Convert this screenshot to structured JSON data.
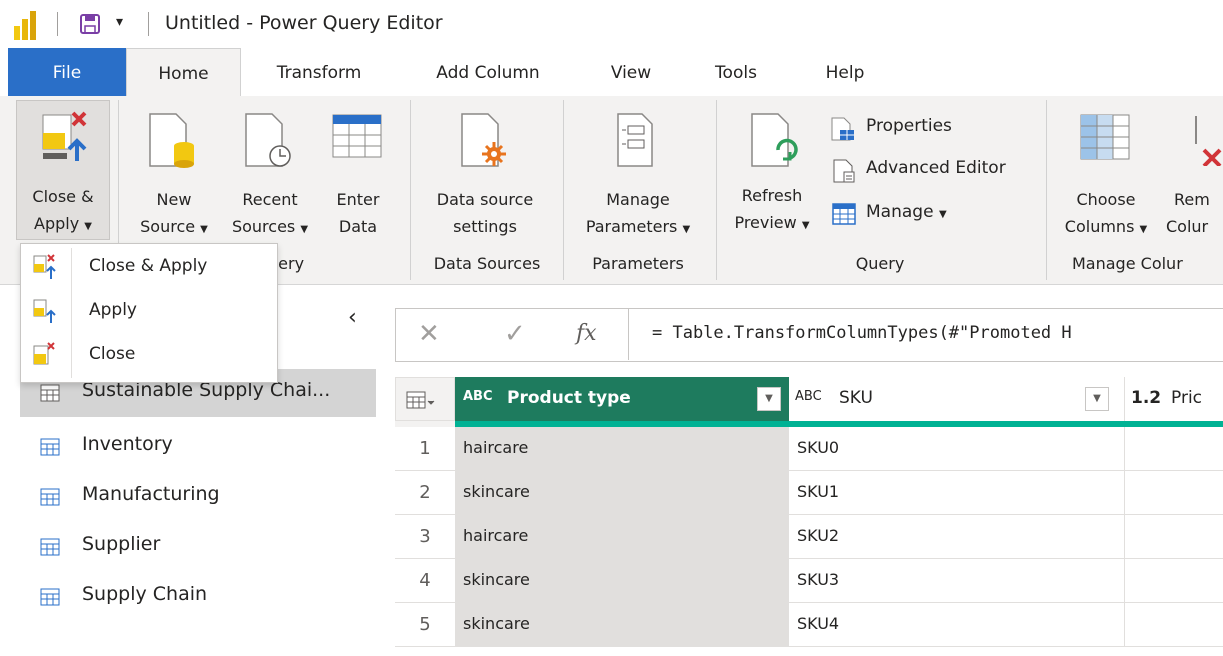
{
  "titlebar": {
    "title": "Untitled - Power Query Editor",
    "qat_dropdown": "▾"
  },
  "tabs": [
    "File",
    "Home",
    "Transform",
    "Add Column",
    "View",
    "Tools",
    "Help"
  ],
  "ribbon": {
    "close_apply": {
      "line1": "Close &",
      "line2": "Apply"
    },
    "new_source": {
      "line1": "New",
      "line2": "Source"
    },
    "recent_sources": {
      "line1": "Recent",
      "line2": "Sources"
    },
    "enter_data": {
      "line1": "Enter",
      "line2": "Data"
    },
    "data_source_settings": {
      "line1": "Data source",
      "line2": "settings"
    },
    "manage_parameters": {
      "line1": "Manage",
      "line2": "Parameters"
    },
    "refresh_preview": {
      "line1": "Refresh",
      "line2": "Preview"
    },
    "properties": "Properties",
    "advanced_editor": "Advanced Editor",
    "manage": "Manage",
    "choose_columns": {
      "line1": "Choose",
      "line2": "Columns"
    },
    "remove_columns": {
      "line1": "Rem",
      "line2": "Colur"
    },
    "groups": {
      "new_query": "uery",
      "data_sources": "Data Sources",
      "parameters": "Parameters",
      "query": "Query",
      "manage_columns": "Manage Colur"
    }
  },
  "dropdown": {
    "items": [
      "Close & Apply",
      "Apply",
      "Close"
    ]
  },
  "queries": [
    "Sustainable Supply Chai...",
    "Inventory",
    "Manufacturing",
    "Supplier",
    "Supply Chain"
  ],
  "formula": {
    "cancel": "✕",
    "confirm": "✓",
    "fx": "fx",
    "text": "= Table.TransformColumnTypes(#\"Promoted H"
  },
  "grid": {
    "columns": [
      {
        "type": "ABC",
        "name": "Product type"
      },
      {
        "type": "ABC",
        "name": "SKU"
      },
      {
        "type": "1.2",
        "name": "Pric"
      }
    ],
    "rows": [
      {
        "n": "1",
        "product_type": "haircare",
        "sku": "SKU0"
      },
      {
        "n": "2",
        "product_type": "skincare",
        "sku": "SKU1"
      },
      {
        "n": "3",
        "product_type": "haircare",
        "sku": "SKU2"
      },
      {
        "n": "4",
        "product_type": "skincare",
        "sku": "SKU3"
      },
      {
        "n": "5",
        "product_type": "skincare",
        "sku": "SKU4"
      }
    ]
  },
  "colors": {
    "file_tab": "#2a6fc8",
    "selected_column": "#1e7b5e",
    "accent_teal": "#00b294"
  }
}
